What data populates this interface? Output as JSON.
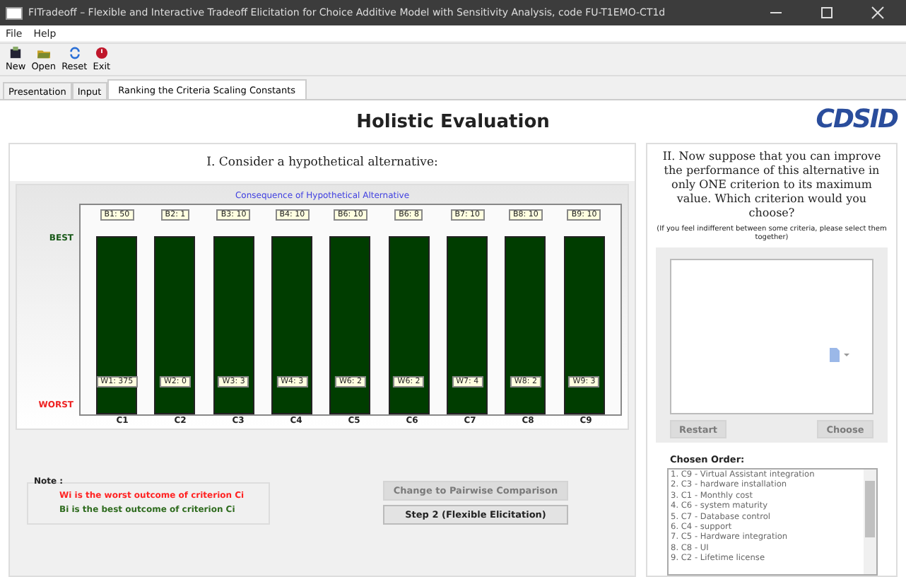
{
  "window": {
    "title": "FITradeoff – Flexible and Interactive Tradeoff Elicitation for Choice Additive Model with Sensitivity Analysis, code FU-T1EMO-CT1d"
  },
  "menu": [
    "File",
    "Help"
  ],
  "toolbar": [
    {
      "label": "New",
      "kind": "new"
    },
    {
      "label": "Open",
      "kind": "open"
    },
    {
      "label": "Reset",
      "kind": "reset"
    },
    {
      "label": "Exit",
      "kind": "exit"
    }
  ],
  "tabs": [
    {
      "label": "Presentation",
      "selected": false
    },
    {
      "label": "Input",
      "selected": false
    },
    {
      "label": "Ranking the Criteria Scaling Constants",
      "selected": true
    }
  ],
  "header": {
    "title": "Holistic Evaluation",
    "logo": "CDSID"
  },
  "left_panel": {
    "heading": "I.   Consider a hypothetical alternative:",
    "chart": {
      "title": "Consequence of Hypothetical Alternative",
      "best_label": "BEST",
      "worst_label": "WORST",
      "criteria": [
        {
          "name": "C1",
          "best": "B1: 50",
          "worst": "W1: 375"
        },
        {
          "name": "C2",
          "best": "B2: 1",
          "worst": "W2: 0"
        },
        {
          "name": "C3",
          "best": "B3: 10",
          "worst": "W3: 3"
        },
        {
          "name": "C4",
          "best": "B4: 10",
          "worst": "W4: 3"
        },
        {
          "name": "C5",
          "best": "B6: 10",
          "worst": "W6: 2"
        },
        {
          "name": "C6",
          "best": "B6: 8",
          "worst": "W6: 2"
        },
        {
          "name": "C7",
          "best": "B7: 10",
          "worst": "W7: 4"
        },
        {
          "name": "C8",
          "best": "B8: 10",
          "worst": "W8: 2"
        },
        {
          "name": "C9",
          "best": "B9: 10",
          "worst": "W9: 3"
        }
      ]
    },
    "note": {
      "title": "Note :",
      "lines": [
        {
          "text": "Wi is the worst outcome of criterion Ci",
          "kind": "worst"
        },
        {
          "text": "Bi is the best outcome of criterion Ci",
          "kind": "best"
        }
      ]
    },
    "buttons": [
      {
        "label": "Change to Pairwise Comparison",
        "disabled": true
      },
      {
        "label": "Step 2 (Flexible Elicitation)",
        "disabled": false
      }
    ]
  },
  "right_panel": {
    "question": "II.   Now suppose that you can improve the performance of this alternative in only ONE criterion to its maximum value. Which criterion would you choose?",
    "hint": "(If you feel indifferent between some criteria, please select them together)",
    "buttons": [
      {
        "label": "Restart",
        "disabled": true
      },
      {
        "label": "Choose",
        "disabled": true
      }
    ],
    "order_title": "Chosen Order:",
    "order": [
      "1. C9 - Virtual Assistant integration",
      "2. C3 - hardware installation",
      "3. C1 - Monthly cost",
      "4. C6 - system maturity",
      "5. C7 - Database control",
      "6. C4 - support",
      "7. C5 - Hardware integration",
      "8. C8 - UI",
      "9. C2 - Lifetime license"
    ]
  }
}
